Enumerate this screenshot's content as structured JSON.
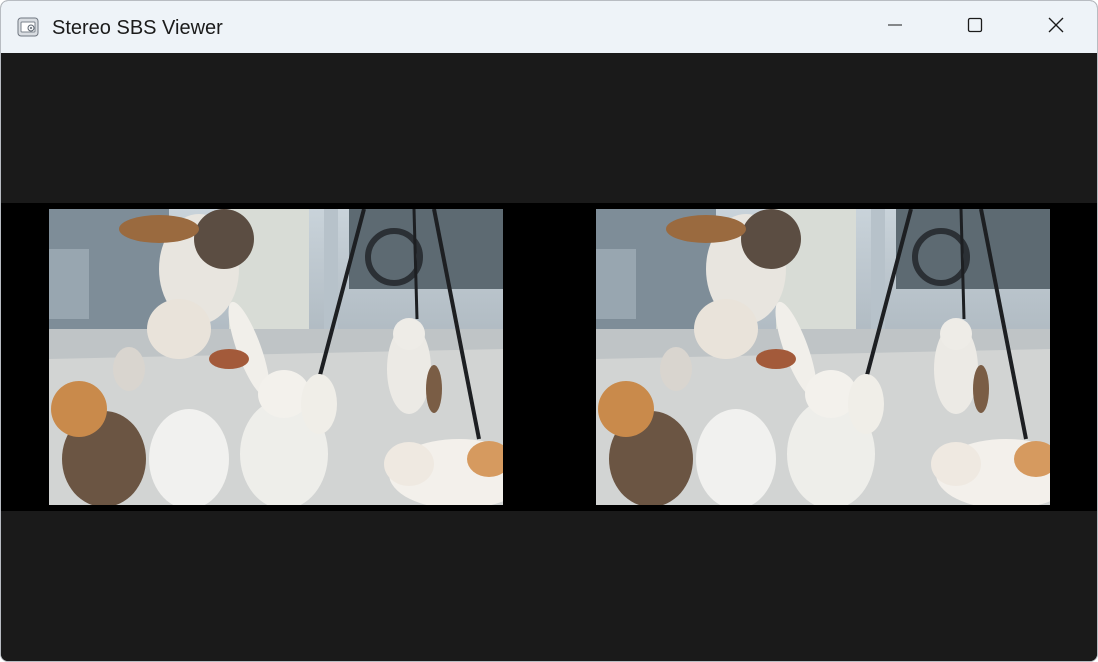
{
  "window": {
    "title": "Stereo SBS Viewer",
    "app_icon": "image-viewer-icon",
    "controls": {
      "minimize_icon": "minimize-icon",
      "maximize_icon": "maximize-icon",
      "close_icon": "close-icon"
    }
  },
  "viewer": {
    "mode": "side-by-side stereo",
    "left_view": {
      "content": "photo-cats-left-eye"
    },
    "right_view": {
      "content": "photo-cats-right-eye"
    },
    "colors": {
      "background": "#1a1a1a",
      "letterbox": "#000000",
      "titlebar": "#eef3f8"
    }
  }
}
